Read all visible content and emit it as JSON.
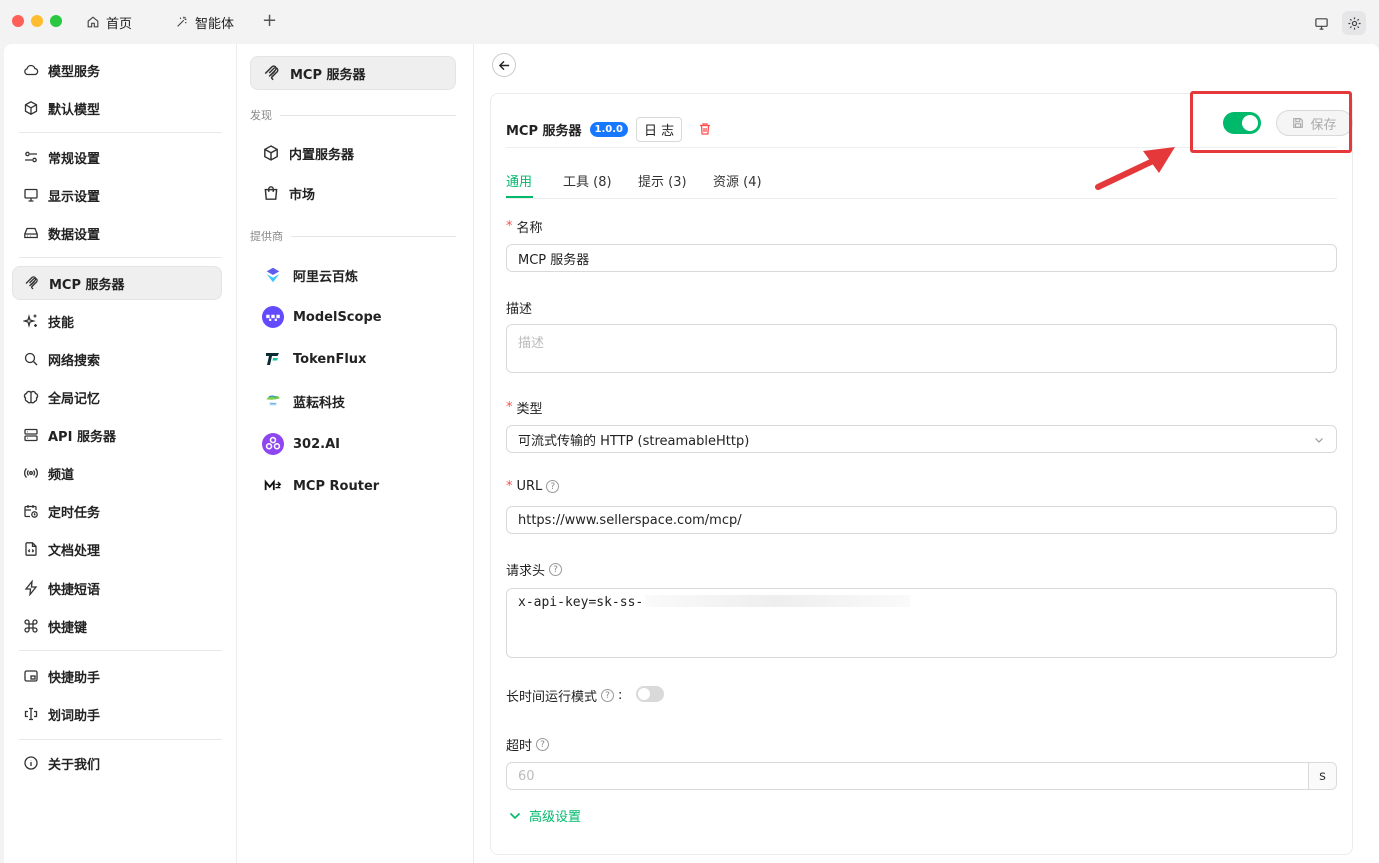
{
  "titlebar": {
    "tabs": [
      {
        "label": "首页",
        "icon": "home-icon"
      },
      {
        "label": "智能体",
        "icon": "sparkle-icon"
      }
    ],
    "add_tab_glyph": "+"
  },
  "sidebar": {
    "items": [
      {
        "label": "模型服务",
        "icon": "cloud-icon"
      },
      {
        "label": "默认模型",
        "icon": "cube-icon"
      },
      {
        "label": "常规设置",
        "icon": "sliders-icon"
      },
      {
        "label": "显示设置",
        "icon": "monitor-icon"
      },
      {
        "label": "数据设置",
        "icon": "drive-icon"
      },
      {
        "label": "MCP 服务器",
        "icon": "mcp-icon",
        "active": true
      },
      {
        "label": "技能",
        "icon": "sparkles-icon"
      },
      {
        "label": "网络搜索",
        "icon": "search-icon"
      },
      {
        "label": "全局记忆",
        "icon": "brain-icon"
      },
      {
        "label": "API 服务器",
        "icon": "server-icon"
      },
      {
        "label": "频道",
        "icon": "broadcast-icon"
      },
      {
        "label": "定时任务",
        "icon": "calendar-clock-icon"
      },
      {
        "label": "文档处理",
        "icon": "file-code-icon"
      },
      {
        "label": "快捷短语",
        "icon": "zap-icon"
      },
      {
        "label": "快捷键",
        "icon": "command-icon"
      },
      {
        "label": "快捷助手",
        "icon": "app-window-icon"
      },
      {
        "label": "划词助手",
        "icon": "text-cursor-icon"
      },
      {
        "label": "关于我们",
        "icon": "info-icon"
      }
    ]
  },
  "middle": {
    "top_item": "MCP 服务器",
    "section_discover": "发现",
    "discover_items": [
      {
        "label": "内置服务器",
        "icon": "cube-icon"
      },
      {
        "label": "市场",
        "icon": "shopping-bag-icon"
      }
    ],
    "section_providers": "提供商",
    "providers": [
      {
        "label": "阿里云百炼",
        "icon": "bailian-logo-icon"
      },
      {
        "label": "ModelScope",
        "icon": "modelscope-logo-icon"
      },
      {
        "label": "TokenFlux",
        "icon": "tokenflux-logo-icon"
      },
      {
        "label": "蓝耘科技",
        "icon": "lanyun-logo-icon"
      },
      {
        "label": "302.AI",
        "icon": "302ai-logo-icon"
      },
      {
        "label": "MCP Router",
        "icon": "mcprouter-logo-icon"
      }
    ]
  },
  "main": {
    "title": "MCP 服务器",
    "version": "1.0.0",
    "log_label": "日 志",
    "enabled": true,
    "save_label": "保存",
    "tabs": [
      "通用",
      "工具 (8)",
      "提示 (3)",
      "资源 (4)"
    ],
    "form": {
      "name_label": "名称",
      "name_value": "MCP 服务器",
      "desc_label": "描述",
      "desc_placeholder": "描述",
      "type_label": "类型",
      "type_value": "可流式传输的 HTTP (streamableHttp)",
      "url_label": "URL",
      "url_value": "https://www.sellerspace.com/mcp/",
      "headers_label": "请求头",
      "headers_value": "x-api-key=sk-ss-",
      "long_running_label": "长时间运行模式",
      "long_running_suffix": ":",
      "long_running_enabled": false,
      "timeout_label": "超时",
      "timeout_placeholder": "60",
      "timeout_unit": "s",
      "advanced_label": "高级设置"
    }
  },
  "colors": {
    "accent": "#00b96b",
    "annotation": "#e5383b",
    "badge": "#1677ff",
    "required": "#ff4d4f"
  }
}
